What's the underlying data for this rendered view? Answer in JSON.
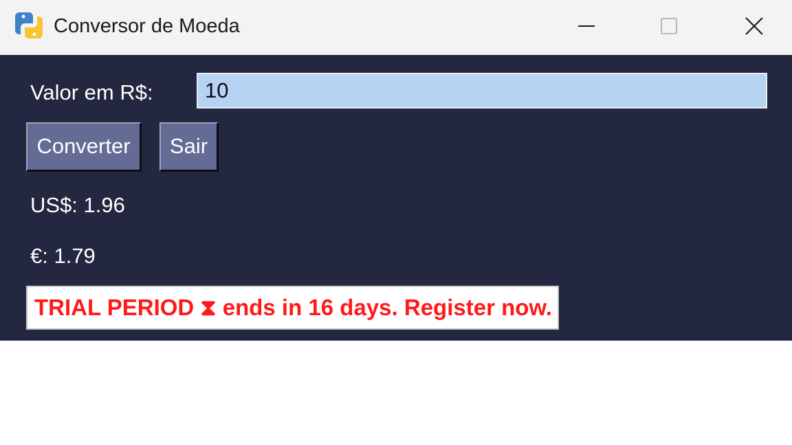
{
  "window": {
    "title": "Conversor de Moeda",
    "controls": {
      "minimize": "minimize-icon",
      "maximize": "maximize-icon",
      "close": "close-icon"
    },
    "app_icon": "python-logo-icon"
  },
  "form": {
    "valor_label": "Valor em R$:",
    "valor_value": "10"
  },
  "buttons": {
    "convert_label": "Converter",
    "exit_label": "Sair"
  },
  "results": {
    "usd": "US$: 1.96",
    "eur": "€: 1.79"
  },
  "trial_banner": {
    "text": "TRIAL PERIOD ⧗ ends in 16 days. Register now.",
    "color": "#ff1a1a"
  },
  "colors": {
    "window_bg": "#232740",
    "titlebar_bg": "#f3f3f3",
    "input_bg": "#b6d3f1",
    "button_bg": "#646c95"
  }
}
